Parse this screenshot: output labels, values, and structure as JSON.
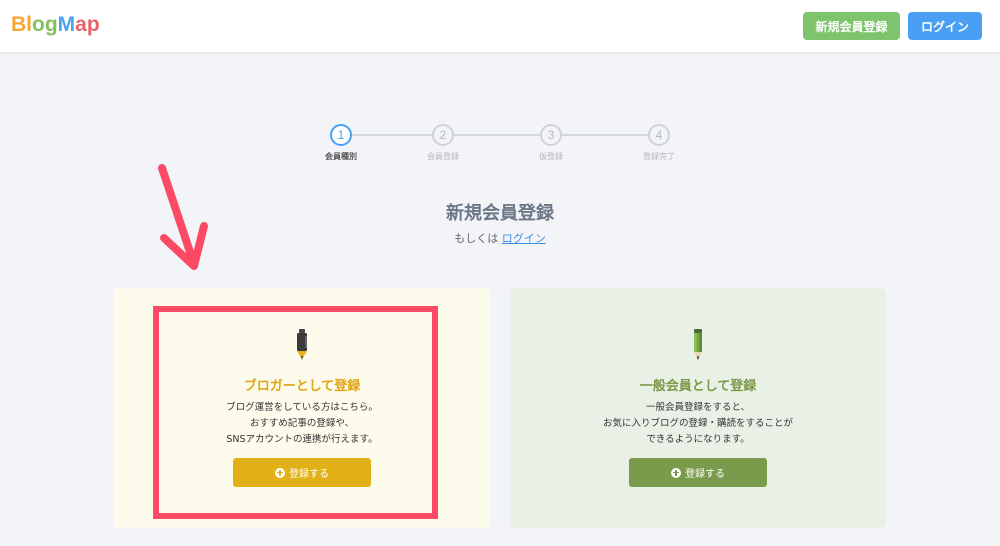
{
  "header": {
    "logo_letters": [
      "B",
      "l",
      "o",
      "g",
      "M",
      "a",
      "p"
    ],
    "logo_colors": [
      "#f7a531",
      "#f7a531",
      "#82c15a",
      "#82c15a",
      "#4aa4ec",
      "#e8646a",
      "#e8646a"
    ],
    "register_label": "新規会員登録",
    "login_label": "ログイン"
  },
  "stepper": {
    "steps": [
      {
        "number": "1",
        "label": "会員種別",
        "active": true
      },
      {
        "number": "2",
        "label": "会員登録",
        "active": false
      },
      {
        "number": "3",
        "label": "仮登録",
        "active": false
      },
      {
        "number": "4",
        "label": "登録完了",
        "active": false
      }
    ]
  },
  "main": {
    "title": "新規会員登録",
    "or_text": "もしくは",
    "login_link": "ログイン"
  },
  "cards": {
    "blogger": {
      "icon": "pen-icon",
      "title": "ブロガーとして登録",
      "desc": [
        "ブログ運営をしている方はこちら。",
        "おすすめ記事の登録や、",
        "SNSアカウントの連携が行えます。"
      ],
      "button": "登録する",
      "accent": "#e1b117"
    },
    "general": {
      "icon": "pencil-icon",
      "title": "一般会員として登録",
      "desc": [
        "一般会員登録をすると、",
        "お気に入りブログの登録・購読をすることが",
        "できるようになります。"
      ],
      "button": "登録する",
      "accent": "#7a9a4c"
    }
  },
  "annotation": {
    "arrow_color": "#fc4a64",
    "box_color": "#fc4a64"
  }
}
